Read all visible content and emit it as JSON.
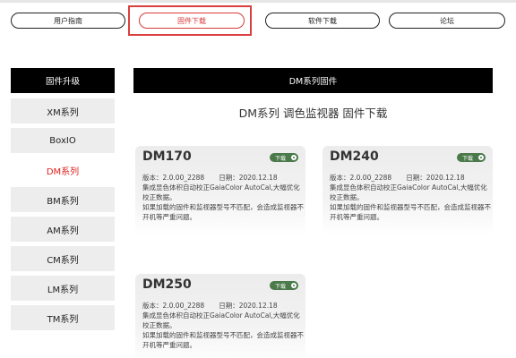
{
  "nav": {
    "items": [
      {
        "label": "用户指南"
      },
      {
        "label": "固件下载"
      },
      {
        "label": "软件下载"
      },
      {
        "label": "论坛"
      }
    ]
  },
  "sidebar": {
    "header": "固件升级",
    "items": [
      {
        "label": "XM系列"
      },
      {
        "label": "BoxIO"
      },
      {
        "label": "DM系列"
      },
      {
        "label": "BM系列"
      },
      {
        "label": "AM系列"
      },
      {
        "label": "CM系列"
      },
      {
        "label": "LM系列"
      },
      {
        "label": "TM系列"
      }
    ]
  },
  "main": {
    "header": "DM系列固件",
    "title": "DM系列 调色监视器 固件下载",
    "cards": [
      {
        "model": "DM170",
        "download_label": "下载",
        "version": "版本：2.0.00_2288",
        "date": "日期：2020.12.18",
        "description": "集成显色体积自动校正GaiaColor AutoCal,大幅优化校正数据。",
        "warning": "如果加载的固件和监视器型号不匹配，会造成监视器不开机等严重问题。"
      },
      {
        "model": "DM240",
        "download_label": "下载",
        "version": "版本：2.0.00_2288",
        "date": "日期：2020.12.18",
        "description": "集成显色体积自动校正GaiaColor AutoCal,大幅优化校正数据。",
        "warning": "如果加载的固件和监视器型号不匹配，会造成监视器不开机等严重问题。"
      },
      {
        "model": "DM250",
        "download_label": "下载",
        "version": "版本：2.0.00_2288",
        "date": "日期：2020.12.18",
        "description": "集成显色体积自动校正GaiaColor AutoCal,大幅优化校正数据。",
        "warning": "如果加载的固件和监视器型号不匹配，会造成监视器不开机等严重问题。"
      }
    ]
  },
  "colors": {
    "accent_red": "#d9403f",
    "download_green": "#4a7a4a",
    "header_black": "#000000"
  }
}
